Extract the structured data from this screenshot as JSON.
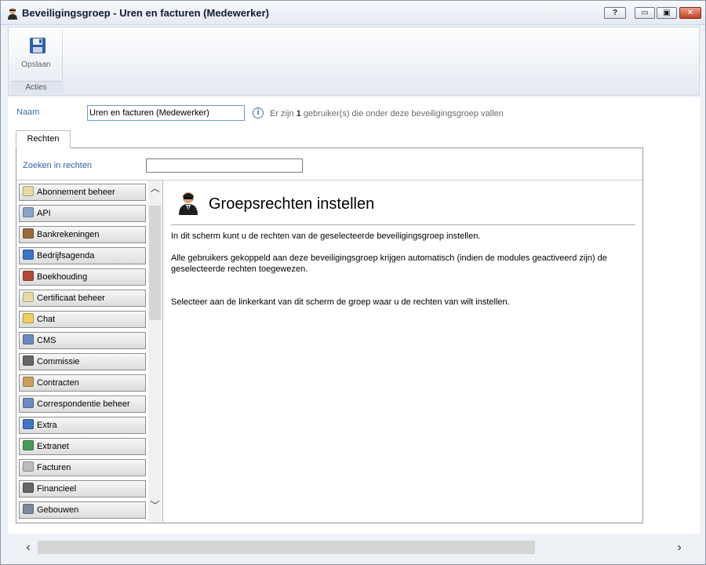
{
  "window": {
    "title": "Beveiligingsgroep - Uren en facturen (Medewerker)",
    "help_label": "?",
    "min_label": "▭",
    "max_label": "▣",
    "close_label": "✕"
  },
  "ribbon": {
    "save_label": "Opslaan",
    "group_label": "Acties"
  },
  "form": {
    "naam_label": "Naam",
    "naam_value": "Uren en facturen (Medewerker)",
    "info_prefix": "Er zijn",
    "info_count": "1",
    "info_suffix": "gebruiker(s) die onder deze beveiligingsgroep vallen"
  },
  "tabs": [
    {
      "label": "Rechten"
    }
  ],
  "search": {
    "label": "Zoeken in rechten",
    "value": ""
  },
  "modules": [
    {
      "label": "Abonnement beheer",
      "icon": "scroll-icon",
      "color": "#e8d8a8"
    },
    {
      "label": "API",
      "icon": "api-icon",
      "color": "#8aa4c8"
    },
    {
      "label": "Bankrekeningen",
      "icon": "chest-icon",
      "color": "#9a6a3a"
    },
    {
      "label": "Bedrijfsagenda",
      "icon": "calendar-icon",
      "color": "#3f73c4"
    },
    {
      "label": "Boekhouding",
      "icon": "chart-icon",
      "color": "#b24a3a"
    },
    {
      "label": "Certificaat beheer",
      "icon": "certificate-icon",
      "color": "#e8d8a8"
    },
    {
      "label": "Chat",
      "icon": "chat-bubble-icon",
      "color": "#f0cf5a"
    },
    {
      "label": "CMS",
      "icon": "cms-icon",
      "color": "#6a8ac0"
    },
    {
      "label": "Commissie",
      "icon": "stamp-icon",
      "color": "#666666"
    },
    {
      "label": "Contracten",
      "icon": "contract-icon",
      "color": "#c8a060"
    },
    {
      "label": "Correspondentie beheer",
      "icon": "mail-icon",
      "color": "#6a8ac0"
    },
    {
      "label": "Extra",
      "icon": "external-icon",
      "color": "#3f73c4"
    },
    {
      "label": "Extranet",
      "icon": "extranet-icon",
      "color": "#4a9a5a"
    },
    {
      "label": "Facturen",
      "icon": "invoice-icon",
      "color": "#bbbbbb"
    },
    {
      "label": "Financieel",
      "icon": "finance-icon",
      "color": "#666666"
    },
    {
      "label": "Gebouwen",
      "icon": "building-icon",
      "color": "#7a8a9a"
    }
  ],
  "detail": {
    "title": "Groepsrechten instellen",
    "para1": "In dit scherm kunt u de rechten van de geselecteerde beveiligingsgroep instellen.",
    "para2": "Alle gebruikers gekoppeld aan deze beveiligingsgroep krijgen automatisch (indien de modules geactiveerd zijn) de geselecteerde rechten toegewezen.",
    "para3": "Selecteer aan de linkerkant van dit scherm de groep waar u de rechten van wilt instellen."
  },
  "scroll": {
    "up": "︿",
    "down": "﹀",
    "left": "‹",
    "right": "›"
  }
}
